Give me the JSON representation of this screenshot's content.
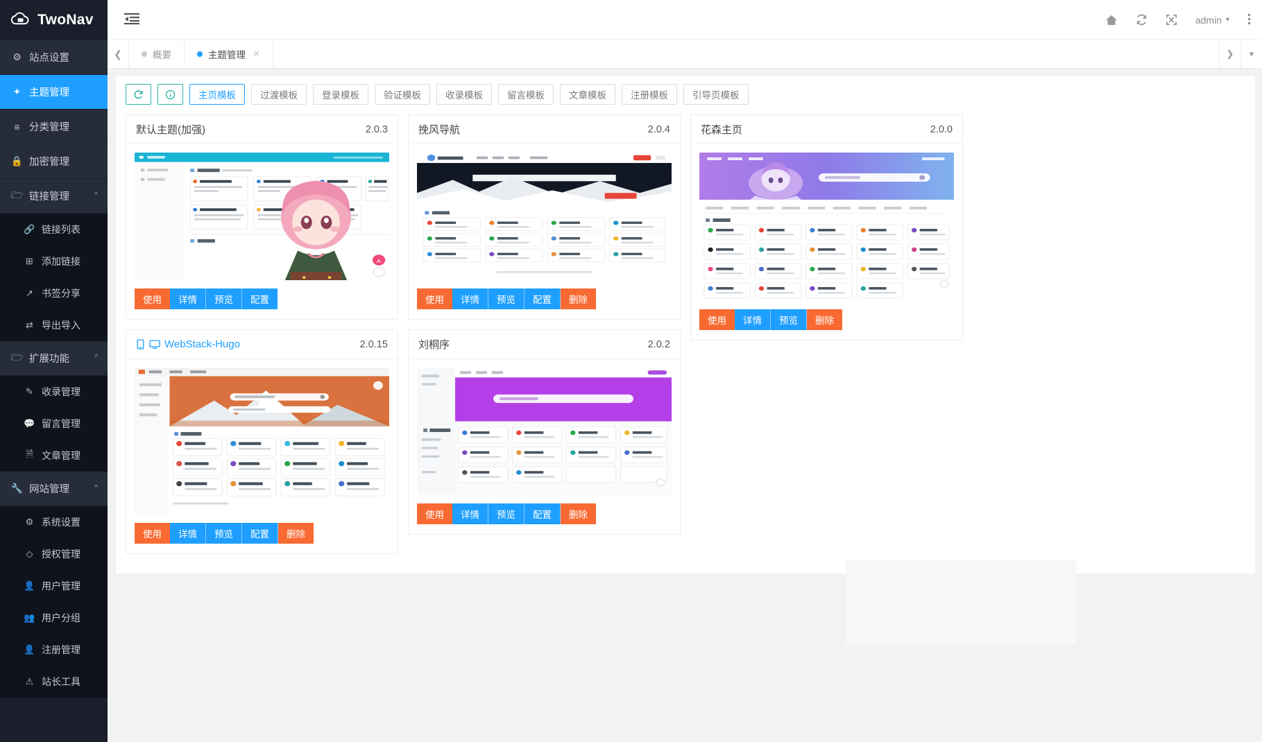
{
  "brand": {
    "name": "TwoNav",
    "logo_icon": "cloud-logo-icon"
  },
  "sidebar": {
    "items": [
      {
        "label": "站点设置",
        "icon": "gear-icon",
        "active": false,
        "expandable": false
      },
      {
        "label": "主题管理",
        "icon": "magic-wand-icon",
        "active": true,
        "expandable": false
      },
      {
        "label": "分类管理",
        "icon": "list-icon",
        "active": false,
        "expandable": false
      },
      {
        "label": "加密管理",
        "icon": "lock-icon",
        "active": false,
        "expandable": false
      },
      {
        "label": "链接管理",
        "icon": "folder-icon",
        "active": false,
        "expandable": true,
        "children": [
          {
            "label": "链接列表",
            "icon": "link-icon"
          },
          {
            "label": "添加链接",
            "icon": "plus-square-icon"
          },
          {
            "label": "书签分享",
            "icon": "external-link-icon"
          },
          {
            "label": "导出导入",
            "icon": "exchange-icon"
          }
        ]
      },
      {
        "label": "扩展功能",
        "icon": "folder-icon",
        "active": false,
        "expandable": true,
        "children": [
          {
            "label": "收录管理",
            "icon": "pencil-icon"
          },
          {
            "label": "留言管理",
            "icon": "comment-icon"
          },
          {
            "label": "文章管理",
            "icon": "file-icon"
          }
        ]
      },
      {
        "label": "网站管理",
        "icon": "wrench-icon",
        "active": false,
        "expandable": true,
        "children": [
          {
            "label": "系统设置",
            "icon": "cogs-icon"
          },
          {
            "label": "授权管理",
            "icon": "diamond-icon"
          },
          {
            "label": "用户管理",
            "icon": "user-icon"
          },
          {
            "label": "用户分组",
            "icon": "users-icon"
          },
          {
            "label": "注册管理",
            "icon": "user-plus-icon"
          },
          {
            "label": "站长工具",
            "icon": "warning-triangle-icon"
          }
        ]
      }
    ]
  },
  "topbar": {
    "menu_toggle_icon": "indent-menu-icon",
    "icons": [
      {
        "name": "home-icon",
        "glyph": "⌂"
      },
      {
        "name": "refresh-icon",
        "glyph": "↻"
      },
      {
        "name": "fullscreen-icon",
        "glyph": "⤢"
      }
    ],
    "user": "admin",
    "user_caret": "⌄",
    "more_icon": "vertical-dots-icon"
  },
  "tabbar": {
    "prev_icon": "chevron-left-icon",
    "next_icon": "chevron-right-icon",
    "dropdown_icon": "chevron-down-icon",
    "tabs": [
      {
        "label": "概要",
        "active": false,
        "closable": false
      },
      {
        "label": "主题管理",
        "active": true,
        "closable": true,
        "close_icon": "close-icon"
      }
    ]
  },
  "toolbar": {
    "refresh": {
      "label": "↻",
      "name": "refresh-button"
    },
    "info": {
      "label": "ⓘ",
      "name": "info-button"
    },
    "filters": [
      {
        "label": "主页模板",
        "active": true
      },
      {
        "label": "过渡模板",
        "active": false
      },
      {
        "label": "登录模板",
        "active": false
      },
      {
        "label": "验证模板",
        "active": false
      },
      {
        "label": "收录模板",
        "active": false
      },
      {
        "label": "留言模板",
        "active": false
      },
      {
        "label": "文章模板",
        "active": false
      },
      {
        "label": "注册模板",
        "active": false
      },
      {
        "label": "引导页模板",
        "active": false
      }
    ]
  },
  "themes": [
    {
      "title": "默认主题(加强)",
      "version": "2.0.3",
      "linked": false,
      "device_icons": [],
      "actions": [
        {
          "label": "使用",
          "style": "orange"
        },
        {
          "label": "详情",
          "style": "blue"
        },
        {
          "label": "预览",
          "style": "blue"
        },
        {
          "label": "配置",
          "style": "blue"
        }
      ]
    },
    {
      "title": "WebStack-Hugo",
      "version": "2.0.15",
      "linked": true,
      "device_icons": [
        "mobile-icon",
        "desktop-icon"
      ],
      "actions": [
        {
          "label": "使用",
          "style": "orange"
        },
        {
          "label": "详情",
          "style": "blue"
        },
        {
          "label": "预览",
          "style": "blue"
        },
        {
          "label": "配置",
          "style": "blue"
        },
        {
          "label": "删除",
          "style": "orange"
        }
      ]
    },
    {
      "title": "挽风导航",
      "version": "2.0.4",
      "linked": false,
      "device_icons": [],
      "actions": [
        {
          "label": "使用",
          "style": "orange"
        },
        {
          "label": "详情",
          "style": "blue"
        },
        {
          "label": "预览",
          "style": "blue"
        },
        {
          "label": "配置",
          "style": "blue"
        },
        {
          "label": "删除",
          "style": "orange"
        }
      ]
    },
    {
      "title": "刘桐序",
      "version": "2.0.2",
      "linked": false,
      "device_icons": [],
      "actions": [
        {
          "label": "使用",
          "style": "orange"
        },
        {
          "label": "详情",
          "style": "blue"
        },
        {
          "label": "预览",
          "style": "blue"
        },
        {
          "label": "配置",
          "style": "blue"
        },
        {
          "label": "删除",
          "style": "orange"
        }
      ]
    },
    {
      "title": "花森主页",
      "version": "2.0.0",
      "linked": false,
      "device_icons": [],
      "actions": [
        {
          "label": "使用",
          "style": "orange"
        },
        {
          "label": "详情",
          "style": "blue"
        },
        {
          "label": "预览",
          "style": "blue"
        },
        {
          "label": "删除",
          "style": "orange"
        }
      ]
    }
  ],
  "colors": {
    "accent_blue": "#1e9fff",
    "accent_orange": "#f96a33",
    "sidebar_bg": "#1b1f2b",
    "sidebar_item_bg": "#262c3a",
    "sidebar_sub_bg": "#0f131c",
    "teal": "#2bb3a3"
  }
}
